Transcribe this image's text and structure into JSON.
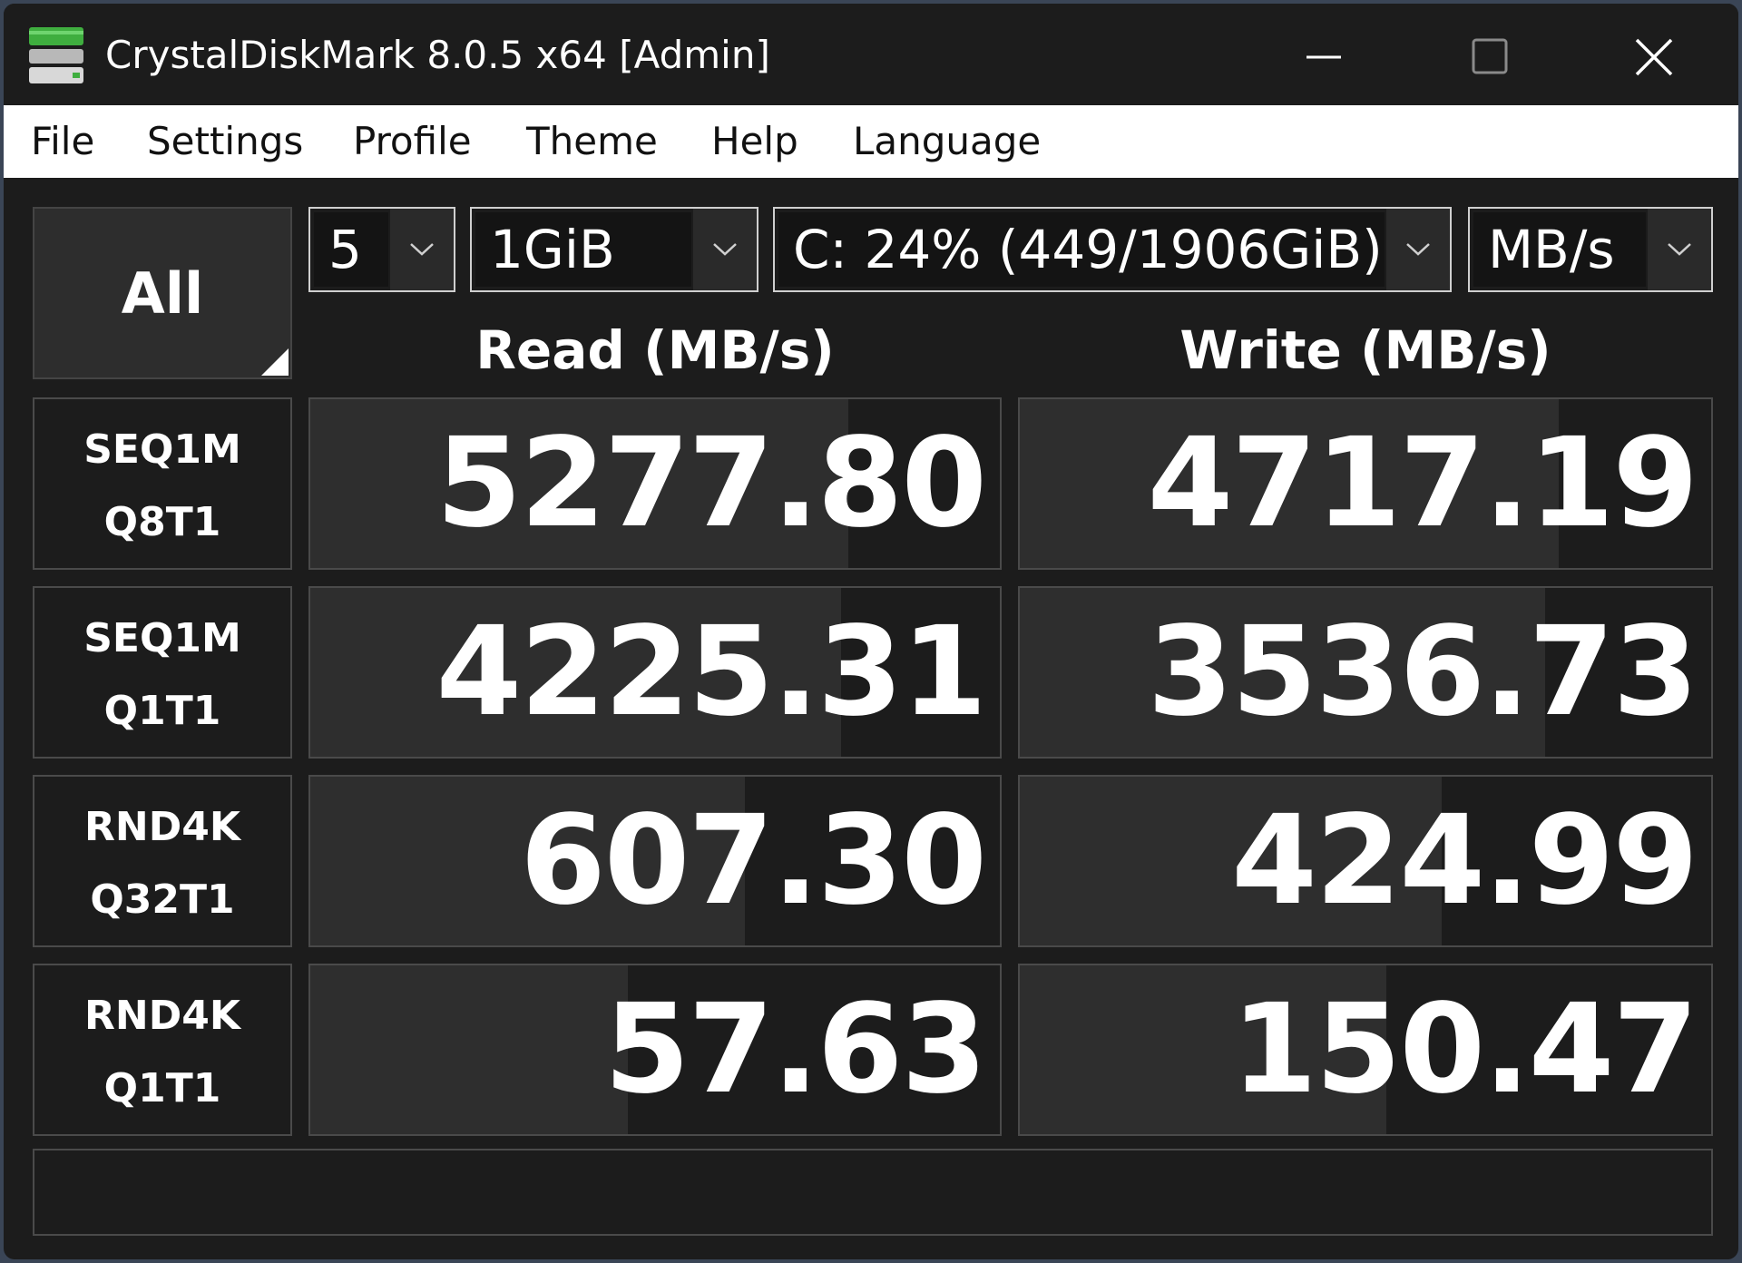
{
  "window": {
    "title": "CrystalDiskMark 8.0.5 x64 [Admin]",
    "icon": "drive-icon"
  },
  "controls": {
    "minimize_icon": "minimize-icon",
    "maximize_icon": "maximize-icon",
    "close_icon": "close-icon"
  },
  "menu": {
    "items": [
      "File",
      "Settings",
      "Profile",
      "Theme",
      "Help",
      "Language"
    ]
  },
  "toolbar": {
    "all_label": "All",
    "count": "5",
    "size": "1GiB",
    "drive": "C: 24% (449/1906GiB)",
    "unit": "MB/s"
  },
  "headers": {
    "read": "Read (MB/s)",
    "write": "Write (MB/s)"
  },
  "results": [
    {
      "test": "SEQ1M",
      "param": "Q8T1",
      "read": "5277.80",
      "write": "4717.19",
      "read_bar_pct": 78,
      "write_bar_pct": 78
    },
    {
      "test": "SEQ1M",
      "param": "Q1T1",
      "read": "4225.31",
      "write": "3536.73",
      "read_bar_pct": 77,
      "write_bar_pct": 76
    },
    {
      "test": "RND4K",
      "param": "Q32T1",
      "read": "607.30",
      "write": "424.99",
      "read_bar_pct": 63,
      "write_bar_pct": 61
    },
    {
      "test": "RND4K",
      "param": "Q1T1",
      "read": "57.63",
      "write": "150.47",
      "read_bar_pct": 46,
      "write_bar_pct": 53
    }
  ],
  "status": "",
  "colors": {
    "background": "#1c1c1c",
    "bar": "#2e2e2e",
    "text": "#ffffff",
    "icon_green": "#4caf50"
  }
}
